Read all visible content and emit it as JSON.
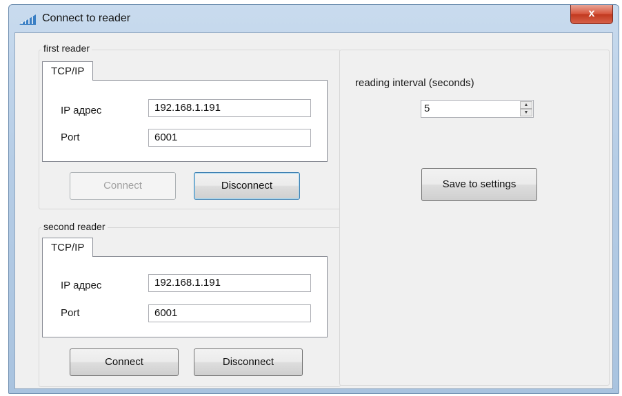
{
  "window": {
    "title": "Connect to reader",
    "close_glyph": "x"
  },
  "first_reader": {
    "group_label": "first reader",
    "tab_label": "TCP/IP",
    "ip_label": "IP адрес",
    "ip_value": "192.168.1.191",
    "port_label": "Port",
    "port_value": "6001",
    "connect_label": "Connect",
    "disconnect_label": "Disconnect"
  },
  "second_reader": {
    "group_label": "second reader",
    "tab_label": "TCP/IP",
    "ip_label": "IP адрес",
    "ip_value": "192.168.1.191",
    "port_label": "Port",
    "port_value": "6001",
    "connect_label": "Connect",
    "disconnect_label": "Disconnect"
  },
  "settings": {
    "interval_label": "reading interval (seconds)",
    "interval_value": "5",
    "save_label": "Save to settings"
  },
  "icons": {
    "app": "reader-signal-icon",
    "close": "close-icon",
    "spin_up": "spin-up-icon",
    "spin_down": "spin-down-icon"
  },
  "colors": {
    "title_bar": "#b6cde6",
    "close_button": "#c1391f",
    "focus_border": "#3c7fb1"
  }
}
